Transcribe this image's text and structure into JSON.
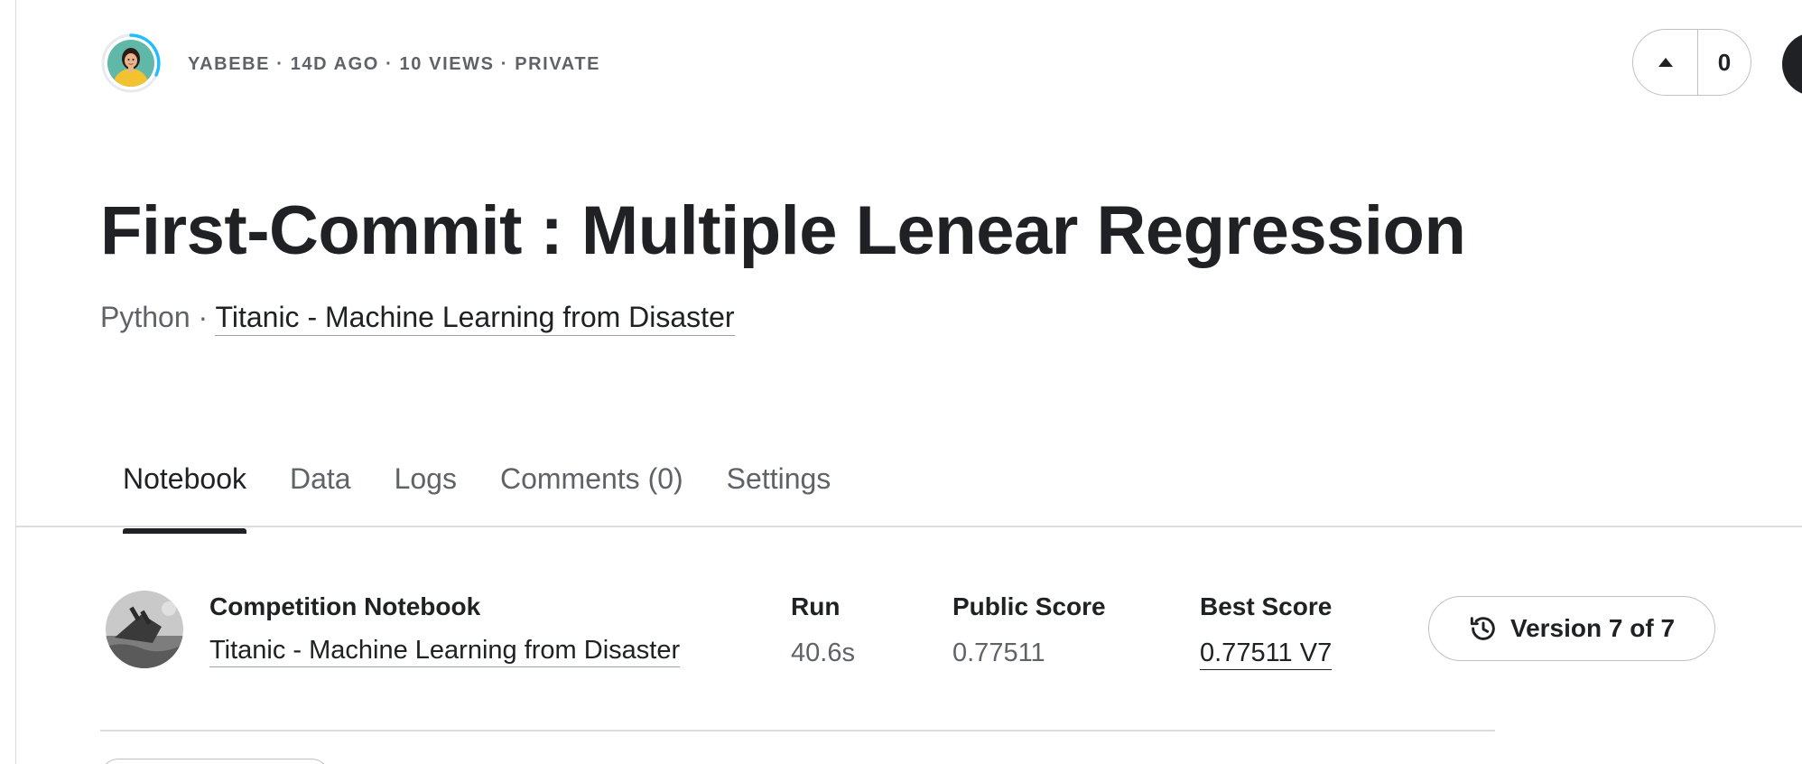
{
  "header": {
    "author": "YABEBE",
    "age": "14D AGO",
    "views": "10 VIEWS",
    "visibility": "PRIVATE",
    "separator": " · ",
    "vote_count": "0",
    "avatar_icon": "user-avatar-icon"
  },
  "title": "First-Commit : Multiple Lenear Regression",
  "subtitle": {
    "language": "Python",
    "separator": " · ",
    "competition_link": "Titanic - Machine Learning from Disaster"
  },
  "tabs": [
    {
      "label": "Notebook",
      "active": true
    },
    {
      "label": "Data",
      "active": false
    },
    {
      "label": "Logs",
      "active": false
    },
    {
      "label": "Comments (0)",
      "active": false
    },
    {
      "label": "Settings",
      "active": false
    }
  ],
  "info": {
    "competition_label": "Competition Notebook",
    "competition_link": "Titanic - Machine Learning from Disaster",
    "run_label": "Run",
    "run_value": "40.6s",
    "public_score_label": "Public Score",
    "public_score_value": "0.77511",
    "best_score_label": "Best Score",
    "best_score_value": "0.77511 V7",
    "version_label": "Version 7 of 7",
    "version_icon": "history-icon"
  },
  "colors": {
    "text_primary": "#202124",
    "text_secondary": "#5f6368",
    "border": "#bdc1c6",
    "avatar_ring": "#20beff"
  }
}
